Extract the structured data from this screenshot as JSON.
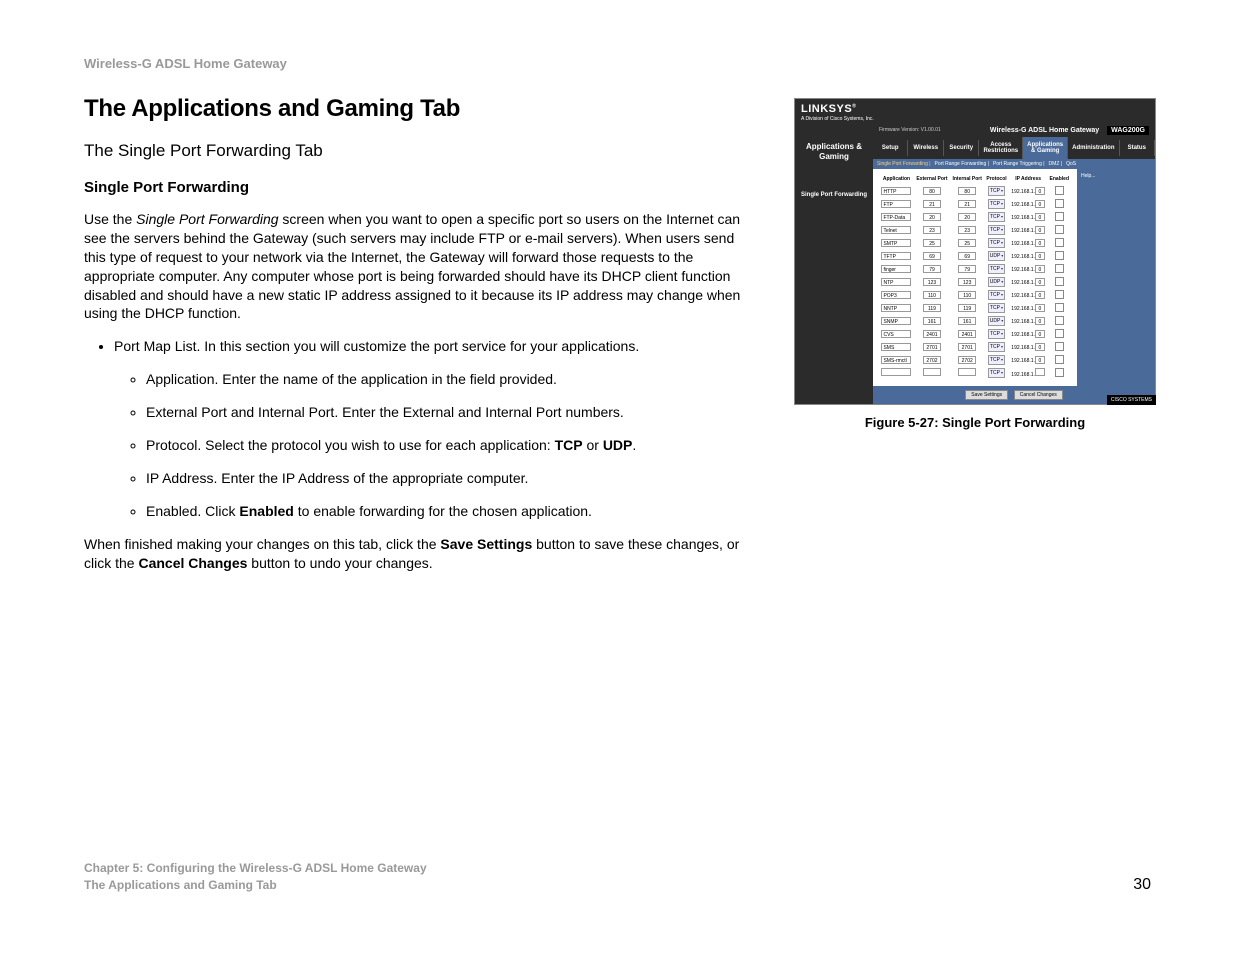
{
  "header": {
    "product": "Wireless-G ADSL Home Gateway"
  },
  "main": {
    "h1": "The Applications and Gaming Tab",
    "h2": "The Single Port Forwarding Tab",
    "h3": "Single Port Forwarding",
    "p1a": "Use the ",
    "p1em": "Single Port Forwarding",
    "p1b": " screen when you want to open a specific port so users on the Internet can see the servers behind the Gateway (such servers may include FTP or e-mail servers). When users send this type of request to your network via the Internet, the Gateway will forward those requests to the appropriate computer. Any computer whose port is being forwarded should have its DHCP client function disabled and should have a new static IP address assigned to it because its IP address may change when using the DHCP function.",
    "li1": "Port Map List. In this section you will customize the port service for your applications.",
    "li1a": "Application. Enter the name of the application in the field provided.",
    "li1b": "External Port and Internal Port. Enter the External and Internal Port numbers.",
    "li1c_a": "Protocol. Select the protocol you wish to use for each application: ",
    "li1c_b1": "TCP",
    "li1c_or": " or ",
    "li1c_b2": "UDP",
    "li1c_end": ".",
    "li1d": "IP Address. Enter the IP Address of the appropriate computer.",
    "li1e_a": "Enabled. Click ",
    "li1e_b": "Enabled",
    "li1e_c": " to enable forwarding for the chosen application.",
    "p2a": "When finished making your changes on this tab, click the ",
    "p2b1": "Save Settings",
    "p2c": " button to save these changes, or click the ",
    "p2b2": "Cancel Changes",
    "p2d": " button to undo your changes."
  },
  "figure": {
    "caption": "Figure 5-27: Single Port Forwarding",
    "brand": "LINKSYS",
    "brand_sub": "A Division of Cisco Systems, Inc.",
    "firmware": "Firmware Version: V1.00.01",
    "title": "Wireless-G ADSL Home Gateway",
    "model": "WAG200G",
    "section": "Applications & Gaming",
    "left_tab": "Single Port Forwarding",
    "nav": [
      "Setup",
      "Wireless",
      "Security",
      "Access Restrictions",
      "Applications & Gaming",
      "Administration",
      "Status"
    ],
    "subnav": [
      "Single Port Forwarding",
      "Port Range Forwarding",
      "Port Range Triggering",
      "DMZ",
      "QoS"
    ],
    "help": "Help...",
    "headers": [
      "Application",
      "External Port",
      "Internal Port",
      "Protocol",
      "IP Address",
      "Enabled"
    ],
    "ip_prefix": "192.168.1.",
    "rows": [
      {
        "app": "HTTP",
        "ext": "80",
        "int": "80",
        "proto": "TCP",
        "ip": "0"
      },
      {
        "app": "FTP",
        "ext": "21",
        "int": "21",
        "proto": "TCP",
        "ip": "0"
      },
      {
        "app": "FTP-Data",
        "ext": "20",
        "int": "20",
        "proto": "TCP",
        "ip": "0"
      },
      {
        "app": "Telnet",
        "ext": "23",
        "int": "23",
        "proto": "TCP",
        "ip": "0"
      },
      {
        "app": "SMTP",
        "ext": "25",
        "int": "25",
        "proto": "TCP",
        "ip": "0"
      },
      {
        "app": "TFTP",
        "ext": "69",
        "int": "69",
        "proto": "UDP",
        "ip": "0"
      },
      {
        "app": "finger",
        "ext": "79",
        "int": "79",
        "proto": "TCP",
        "ip": "0"
      },
      {
        "app": "NTP",
        "ext": "123",
        "int": "123",
        "proto": "UDP",
        "ip": "0"
      },
      {
        "app": "POP3",
        "ext": "110",
        "int": "110",
        "proto": "TCP",
        "ip": "0"
      },
      {
        "app": "NNTP",
        "ext": "119",
        "int": "119",
        "proto": "TCP",
        "ip": "0"
      },
      {
        "app": "SNMP",
        "ext": "161",
        "int": "161",
        "proto": "UDP",
        "ip": "0"
      },
      {
        "app": "CVS",
        "ext": "2401",
        "int": "2401",
        "proto": "TCP",
        "ip": "0"
      },
      {
        "app": "SMS",
        "ext": "2701",
        "int": "2701",
        "proto": "TCP",
        "ip": "0"
      },
      {
        "app": "SMS-rmctl",
        "ext": "2702",
        "int": "2702",
        "proto": "TCP",
        "ip": "0"
      },
      {
        "app": "",
        "ext": "",
        "int": "",
        "proto": "TCP",
        "ip": ""
      }
    ],
    "save": "Save Settings",
    "cancel": "Cancel Changes",
    "cisco": "CISCO SYSTEMS"
  },
  "footer": {
    "line1": "Chapter 5: Configuring the Wireless-G ADSL Home Gateway",
    "line2": "The Applications and Gaming Tab",
    "page": "30"
  }
}
